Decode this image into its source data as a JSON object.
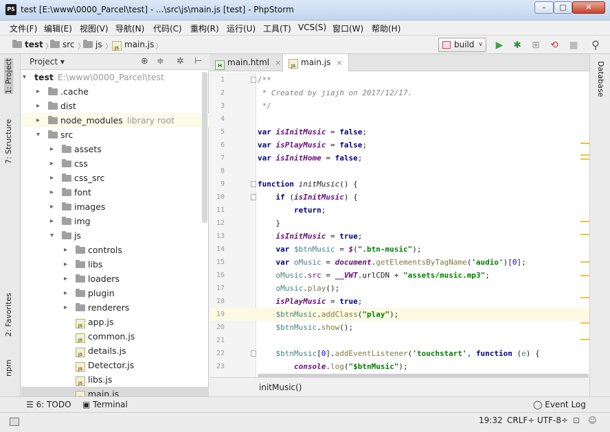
{
  "window": {
    "title": "test [E:\\www\\0000_Parcel\\test] - ...\\src\\js\\main.js [test] - PhpStorm",
    "app_icon": "PS",
    "min_glyph": "–",
    "max_glyph": "□",
    "close_glyph": "✕"
  },
  "menu": [
    "文件(F)",
    "编辑(E)",
    "视图(V)",
    "导航(N)",
    "代码(C)",
    "重构(R)",
    "运行(U)",
    "工具(T)",
    "VCS(S)",
    "窗口(W)",
    "帮助(H)"
  ],
  "breadcrumb": {
    "items": [
      "test",
      "src",
      "js",
      "main.js"
    ],
    "sep": "〉"
  },
  "toolbar": {
    "run_config": "build",
    "run_glyph": "▶",
    "debug_glyph": "✱",
    "coverage_glyph": "⊞",
    "profile_glyph": "⟲",
    "stop_glyph": "■",
    "search_glyph": "⚲",
    "dropdown_glyph": "∨"
  },
  "left_tabs": {
    "project": "1: Project",
    "structure": "7: Structure",
    "favorites": "2: Favorites",
    "npm": "npm"
  },
  "right_tabs": {
    "database": "Database"
  },
  "project_panel": {
    "title": "Project",
    "dropdown": "▾",
    "tools": [
      "⊕",
      "≑",
      "✲",
      "⊢"
    ],
    "tree": [
      {
        "name": "test",
        "extra": "E:\\www\\0000_Parcel\\test",
        "depth": 0,
        "type": "root",
        "expanded": true
      },
      {
        "name": ".cache",
        "depth": 1,
        "type": "folder",
        "expanded": false
      },
      {
        "name": "dist",
        "depth": 1,
        "type": "folder",
        "expanded": false
      },
      {
        "name": "node_modules",
        "extra": "library root",
        "depth": 1,
        "type": "folder",
        "expanded": false,
        "highlight": true
      },
      {
        "name": "src",
        "depth": 1,
        "type": "folder",
        "expanded": true
      },
      {
        "name": "assets",
        "depth": 2,
        "type": "folder",
        "expanded": false
      },
      {
        "name": "css",
        "depth": 2,
        "type": "folder",
        "expanded": false
      },
      {
        "name": "css_src",
        "depth": 2,
        "type": "folder",
        "expanded": false
      },
      {
        "name": "font",
        "depth": 2,
        "type": "folder",
        "expanded": false
      },
      {
        "name": "images",
        "depth": 2,
        "type": "folder",
        "expanded": false
      },
      {
        "name": "img",
        "depth": 2,
        "type": "folder",
        "expanded": false
      },
      {
        "name": "js",
        "depth": 2,
        "type": "folder",
        "expanded": true
      },
      {
        "name": "controls",
        "depth": 3,
        "type": "folder",
        "expanded": false
      },
      {
        "name": "libs",
        "depth": 3,
        "type": "folder",
        "expanded": false
      },
      {
        "name": "loaders",
        "depth": 3,
        "type": "folder",
        "expanded": false
      },
      {
        "name": "plugin",
        "depth": 3,
        "type": "folder",
        "expanded": false
      },
      {
        "name": "renderers",
        "depth": 3,
        "type": "folder",
        "expanded": false
      },
      {
        "name": "app.js",
        "depth": 3,
        "type": "file"
      },
      {
        "name": "common.js",
        "depth": 3,
        "type": "file"
      },
      {
        "name": "details.js",
        "depth": 3,
        "type": "file"
      },
      {
        "name": "Detector.js",
        "depth": 3,
        "type": "file"
      },
      {
        "name": "libs.js",
        "depth": 3,
        "type": "file"
      },
      {
        "name": "main.js",
        "depth": 3,
        "type": "file",
        "selected": true
      }
    ],
    "file_icon_text": "JS",
    "arrow_expanded": "▾",
    "arrow_collapsed": "▸"
  },
  "editor": {
    "tabs": [
      {
        "label": "main.html",
        "icon": "H"
      },
      {
        "label": "main.js",
        "icon": "JS",
        "active": true
      }
    ],
    "close_glyph": "×",
    "current_line": 19,
    "lines": [
      {
        "n": "1",
        "tokens": [
          [
            "c-comment",
            "/**"
          ]
        ],
        "fold": true
      },
      {
        "n": "2",
        "tokens": [
          [
            "c-comment",
            " * Created by jiajh on 2017/12/17."
          ]
        ]
      },
      {
        "n": "3",
        "tokens": [
          [
            "c-comment",
            " */"
          ]
        ]
      },
      {
        "n": "4",
        "tokens": []
      },
      {
        "n": "5",
        "tokens": [
          [
            "c-kw",
            "var "
          ],
          [
            "c-var",
            "isInitMusic"
          ],
          [
            "",
            " = "
          ],
          [
            "c-kw",
            "false"
          ],
          [
            "",
            ";"
          ]
        ]
      },
      {
        "n": "6",
        "tokens": [
          [
            "c-kw",
            "var "
          ],
          [
            "c-var",
            "isPlayMusic"
          ],
          [
            "",
            " = "
          ],
          [
            "c-kw",
            "false"
          ],
          [
            "",
            ";"
          ]
        ]
      },
      {
        "n": "7",
        "tokens": [
          [
            "c-kw",
            "var "
          ],
          [
            "c-var",
            "isInitHome"
          ],
          [
            "",
            " = "
          ],
          [
            "c-kw",
            "false"
          ],
          [
            "",
            ";"
          ]
        ]
      },
      {
        "n": "8",
        "tokens": []
      },
      {
        "n": "9",
        "tokens": [
          [
            "c-kw",
            "function "
          ],
          [
            "c-fn",
            "initMusic"
          ],
          [
            "",
            "() {"
          ]
        ],
        "fold": true
      },
      {
        "n": "10",
        "tokens": [
          [
            "",
            "    "
          ],
          [
            "c-kw",
            "if "
          ],
          [
            "",
            "("
          ],
          [
            "c-var",
            "isInitMusic"
          ],
          [
            "",
            ") {"
          ]
        ],
        "fold": true
      },
      {
        "n": "11",
        "tokens": [
          [
            "",
            "        "
          ],
          [
            "c-kw",
            "return"
          ],
          [
            "",
            ";"
          ]
        ]
      },
      {
        "n": "12",
        "tokens": [
          [
            "",
            "    }"
          ]
        ]
      },
      {
        "n": "13",
        "tokens": [
          [
            "",
            "    "
          ],
          [
            "c-var",
            "isInitMusic"
          ],
          [
            "",
            " = "
          ],
          [
            "c-kw",
            "true"
          ],
          [
            "",
            ";"
          ]
        ]
      },
      {
        "n": "14",
        "tokens": [
          [
            "",
            "    "
          ],
          [
            "c-kw",
            "var "
          ],
          [
            "c-lv",
            "$btnMusic"
          ],
          [
            "",
            " = "
          ],
          [
            "c-glob",
            "$"
          ],
          [
            "",
            "("
          ],
          [
            "c-str",
            "\".btn-music\""
          ],
          [
            "",
            ");"
          ]
        ]
      },
      {
        "n": "15",
        "tokens": [
          [
            "",
            "    "
          ],
          [
            "c-kw",
            "var "
          ],
          [
            "c-lv",
            "oMusic"
          ],
          [
            "",
            " = "
          ],
          [
            "c-glob",
            "document"
          ],
          [
            "",
            "."
          ],
          [
            "c-method",
            "getElementsByTagName"
          ],
          [
            "",
            "("
          ],
          [
            "c-str",
            "'audio'"
          ],
          [
            "",
            ")["
          ],
          [
            "c-num",
            "0"
          ],
          [
            "",
            "];"
          ]
        ]
      },
      {
        "n": "16",
        "tokens": [
          [
            "",
            "    "
          ],
          [
            "c-lv",
            "oMusic"
          ],
          [
            "",
            "."
          ],
          [
            "c-prop",
            "src"
          ],
          [
            "",
            " = "
          ],
          [
            "c-glob",
            "__VWT"
          ],
          [
            "",
            ".urlCDN + "
          ],
          [
            "c-str",
            "\"assets/music.mp3\""
          ],
          [
            "",
            ";"
          ]
        ]
      },
      {
        "n": "17",
        "tokens": [
          [
            "",
            "    "
          ],
          [
            "c-lv",
            "oMusic"
          ],
          [
            "",
            "."
          ],
          [
            "c-method",
            "play"
          ],
          [
            "",
            "();"
          ]
        ]
      },
      {
        "n": "18",
        "tokens": [
          [
            "",
            "    "
          ],
          [
            "c-var",
            "isPlayMusic"
          ],
          [
            "",
            " = "
          ],
          [
            "c-kw",
            "true"
          ],
          [
            "",
            ";"
          ]
        ]
      },
      {
        "n": "19",
        "tokens": [
          [
            "",
            "    "
          ],
          [
            "c-lv",
            "$btnMusic"
          ],
          [
            "",
            "."
          ],
          [
            "c-method",
            "addClass"
          ],
          [
            "",
            "("
          ],
          [
            "c-str",
            "\"play\""
          ],
          [
            "",
            ");"
          ]
        ]
      },
      {
        "n": "20",
        "tokens": [
          [
            "",
            "    "
          ],
          [
            "c-lv",
            "$btnMusic"
          ],
          [
            "",
            "."
          ],
          [
            "c-method",
            "show"
          ],
          [
            "",
            "();"
          ]
        ]
      },
      {
        "n": "21",
        "tokens": []
      },
      {
        "n": "22",
        "tokens": [
          [
            "",
            "    "
          ],
          [
            "c-lv",
            "$btnMusic"
          ],
          [
            "",
            "["
          ],
          [
            "c-num",
            "0"
          ],
          [
            "",
            "]."
          ],
          [
            "c-method",
            "addEventListener"
          ],
          [
            "",
            "("
          ],
          [
            "c-str",
            "'touchstart'"
          ],
          [
            "",
            ", "
          ],
          [
            "c-kw",
            "function "
          ],
          [
            "",
            "("
          ],
          [
            "c-lv",
            "e"
          ],
          [
            "",
            ") {"
          ]
        ],
        "fold": true
      },
      {
        "n": "23",
        "tokens": [
          [
            "",
            "        "
          ],
          [
            "c-glob",
            "console"
          ],
          [
            "",
            "."
          ],
          [
            "c-method",
            "log"
          ],
          [
            "",
            "("
          ],
          [
            "c-str",
            "\"$btnMusic\""
          ],
          [
            "",
            ");"
          ]
        ]
      }
    ],
    "footer_crumb": "initMusic()"
  },
  "bottom_tools": {
    "todo": "6: TODO",
    "terminal": "Terminal",
    "event_log": "Event Log"
  },
  "status": {
    "position": "19:32",
    "line_sep": "CRLF÷",
    "encoding": "UTF-8÷"
  }
}
